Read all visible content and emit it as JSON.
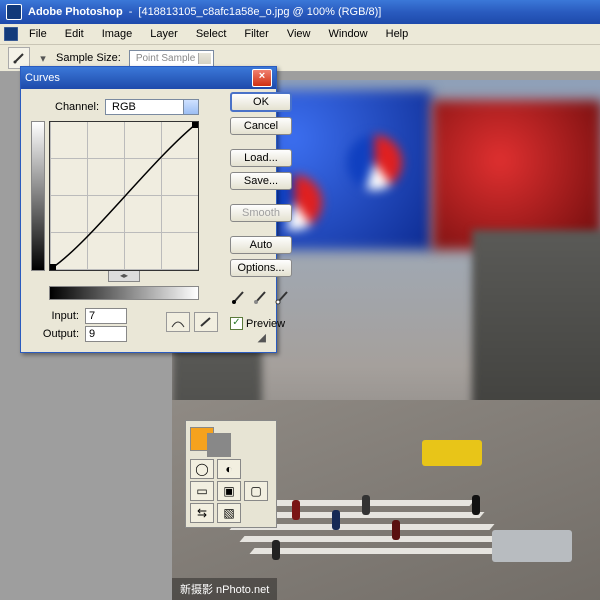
{
  "titlebar": {
    "app": "Adobe Photoshop",
    "doc": "[418813105_c8afc1a58e_o.jpg @ 100% (RGB/8)]"
  },
  "menu": {
    "file": "File",
    "edit": "Edit",
    "image": "Image",
    "layer": "Layer",
    "select": "Select",
    "filter": "Filter",
    "view": "View",
    "window": "Window",
    "help": "Help"
  },
  "optbar": {
    "label": "Sample Size:",
    "value": "Point Sample"
  },
  "curves": {
    "title": "Curves",
    "channel_label": "Channel:",
    "channel_value": "RGB",
    "input_label": "Input:",
    "output_label": "Output:",
    "input": "7",
    "output": "9",
    "ok": "OK",
    "cancel": "Cancel",
    "load": "Load...",
    "save": "Save...",
    "smooth": "Smooth",
    "auto": "Auto",
    "options": "Options...",
    "preview": "Preview"
  },
  "watermark": "新摄影 nPhoto.net"
}
